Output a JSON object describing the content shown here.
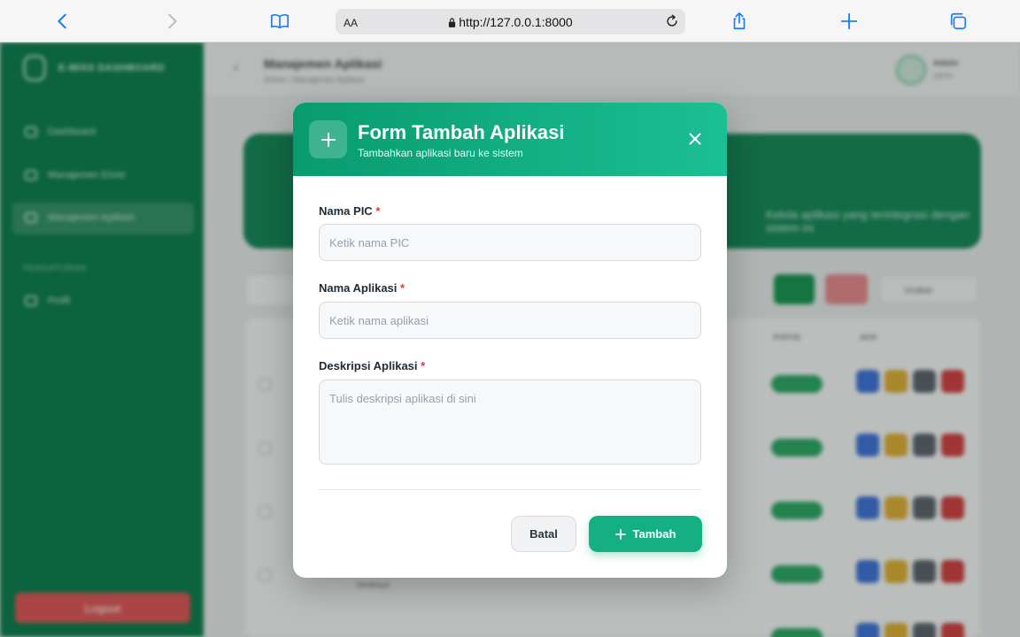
{
  "browser": {
    "aa_label": "AA",
    "url": "http://127.0.0.1:8000"
  },
  "background_app": {
    "brand": "E-MISS DASHBOARD",
    "sidebar_items": [
      "Dashboard",
      "Manajemen Emisi",
      "Manajemen Aplikasi"
    ],
    "sidebar_section": "PENGATURAN",
    "profile_item": "Profil",
    "logout_label": "Logout",
    "page_title": "Manajemen Aplikasi",
    "breadcrumb": "Admin / Manajemen Aplikasi",
    "user_name": "Admin",
    "user_role": "admin",
    "banner_text": "Kelola aplikasi yang terintegrasi dengan sistem ini",
    "filter_label": "Urutkan",
    "table_headers": [
      "STATUS",
      "AKSI"
    ],
    "row_texts": [
      "Deskripsi"
    ]
  },
  "modal": {
    "title": "Form Tambah Aplikasi",
    "subtitle": "Tambahkan aplikasi baru ke sistem",
    "required_mark": "*",
    "fields": [
      {
        "label": "Nama PIC",
        "placeholder": "Ketik nama PIC",
        "value": ""
      },
      {
        "label": "Nama Aplikasi",
        "placeholder": "Ketik nama aplikasi",
        "value": ""
      },
      {
        "label": "Deskripsi Aplikasi",
        "placeholder": "Tulis deskripsi aplikasi di sini",
        "value": ""
      }
    ],
    "cancel_label": "Batal",
    "submit_label": "Tambah"
  },
  "colors": {
    "header_gradient_start": "#089b6e",
    "header_gradient_end": "#1bbf93",
    "submit_button": "#14b083",
    "sidebar": "#067a4a",
    "required": "#e53935"
  }
}
